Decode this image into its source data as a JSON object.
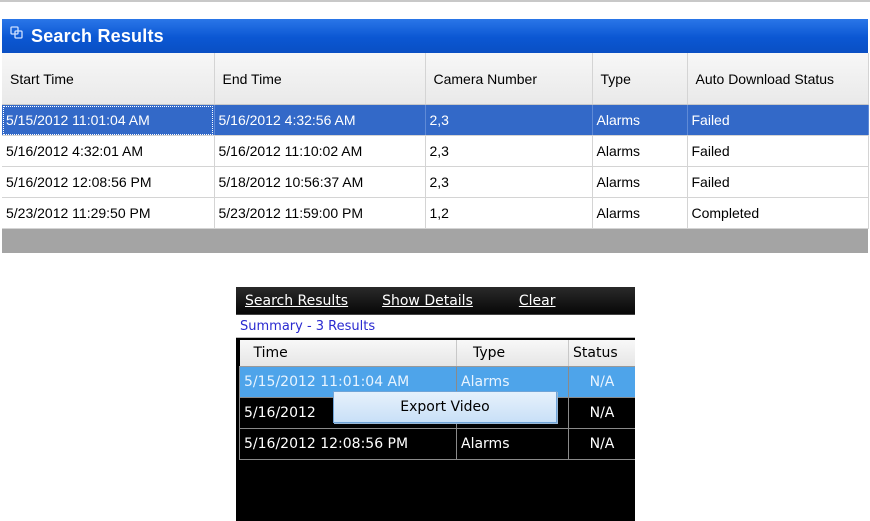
{
  "top": {
    "title": "Search Results",
    "columns": [
      "Start Time",
      "End Time",
      "Camera Number",
      "Type",
      "Auto Download Status"
    ],
    "rows": [
      {
        "start": "5/15/2012 11:01:04 AM",
        "end": "5/16/2012 4:32:56 AM",
        "camera": "2,3",
        "type": "Alarms",
        "status": "Failed"
      },
      {
        "start": "5/16/2012 4:32:01 AM",
        "end": "5/16/2012 11:10:02 AM",
        "camera": "2,3",
        "type": "Alarms",
        "status": "Failed"
      },
      {
        "start": "5/16/2012 12:08:56 PM",
        "end": "5/18/2012 10:56:37 AM",
        "camera": "2,3",
        "type": "Alarms",
        "status": "Failed"
      },
      {
        "start": "5/23/2012 11:29:50 PM",
        "end": "5/23/2012 11:59:00 PM",
        "camera": "1,2",
        "type": "Alarms",
        "status": "Completed"
      }
    ]
  },
  "mini": {
    "header": {
      "title": "Search Results",
      "show_details": "Show Details",
      "clear": "Clear"
    },
    "summary": "Summary - 3 Results",
    "columns": [
      "Time",
      "Type",
      "Status"
    ],
    "rows": [
      {
        "time": "5/15/2012 11:01:04 AM",
        "type": "Alarms",
        "status": "N/A"
      },
      {
        "time": "5/16/2012",
        "type": "",
        "status": "N/A"
      },
      {
        "time": "5/16/2012 12:08:56 PM",
        "type": "Alarms",
        "status": "N/A"
      }
    ]
  },
  "context_menu": {
    "export_video": "Export Video"
  },
  "colors": {
    "title_bar": "#0b57d3",
    "selected_row": "#3369c8",
    "mini_selected_row": "#4ea4ea",
    "summary_text": "#2a2ad0"
  }
}
